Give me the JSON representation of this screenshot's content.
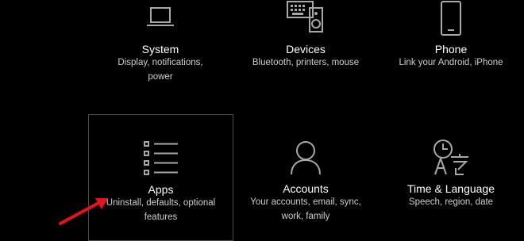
{
  "tiles": [
    {
      "title": "System",
      "desc_line1": "Display, notifications,",
      "desc_line2": "power",
      "icon": "laptop-icon"
    },
    {
      "title": "Devices",
      "desc_line1": "Bluetooth, printers, mouse",
      "desc_line2": "",
      "icon": "keyboard-speaker-icon"
    },
    {
      "title": "Phone",
      "desc_line1": "Link your Android, iPhone",
      "desc_line2": "",
      "icon": "phone-icon"
    },
    {
      "title": "Apps",
      "desc_line1": "Uninstall, defaults, optional",
      "desc_line2": "features",
      "icon": "apps-list-icon"
    },
    {
      "title": "Accounts",
      "desc_line1": "Your accounts, email, sync,",
      "desc_line2": "work, family",
      "icon": "person-icon"
    },
    {
      "title": "Time & Language",
      "desc_line1": "Speech, region, date",
      "desc_line2": "",
      "icon": "time-language-icon"
    }
  ],
  "colors": {
    "background": "#000000",
    "icon_stroke": "#a8a8a8",
    "focus_border": "#4b4b4b",
    "annotation_arrow": "#e3141b"
  }
}
